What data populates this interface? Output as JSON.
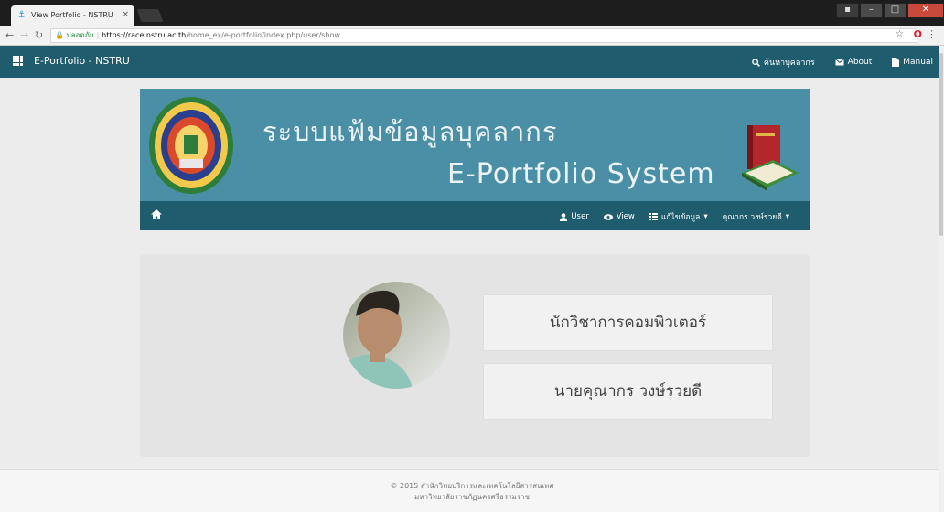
{
  "browser": {
    "tab_title": "View Portfolio - NSTRU",
    "tab_close": "×",
    "secure_label": "ปลอดภัย",
    "url_scheme_host": "https://race.nstru.ac.th",
    "url_path": "/home_ex/e-portfolio/index.php/user/show",
    "icons": [
      "back-icon",
      "forward-icon",
      "reload-icon",
      "lock-icon",
      "star-icon",
      "opera-icon",
      "menu-icon"
    ]
  },
  "navbar": {
    "brand": "E-Portfolio - NSTRU",
    "links": [
      {
        "label": "ค้นหาบุคลากร",
        "icon": "search-icon"
      },
      {
        "label": "About",
        "icon": "envelope-icon"
      },
      {
        "label": "Manual",
        "icon": "document-icon"
      }
    ]
  },
  "banner": {
    "title_thai": "ระบบแฟ้มข้อมูลบุคลากร",
    "title_en": "E-Portfolio System"
  },
  "subnav": {
    "items": [
      {
        "label": "User",
        "icon": "user-icon"
      },
      {
        "label": "View",
        "icon": "eye-icon"
      },
      {
        "label": "แก้ไขข้อมูล",
        "icon": "list-icon",
        "dropdown": true
      },
      {
        "label": "คุณากร วงษ์รวยดี",
        "dropdown": true
      }
    ]
  },
  "profile": {
    "position": "นักวิชาการคอมพิวเตอร์",
    "name": "นายคุณากร วงษ์รวยดี"
  },
  "footer": {
    "line1": "© 2015 สำนักวิทยบริการและเทคโนโลยีสารสนเทศ",
    "line2": "มหาวิทยาลัยราชภัฏนครศรีธรรมราช"
  },
  "colors": {
    "navbar": "#1f5c6e",
    "banner": "#4a8fa6",
    "panel": "#e4e4e4"
  }
}
